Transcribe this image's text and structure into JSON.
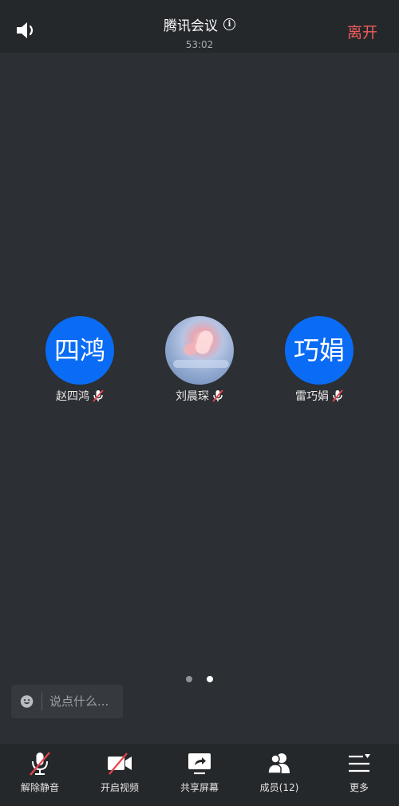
{
  "header": {
    "title": "腾讯会议",
    "info_icon": "info-icon",
    "timer": "53:02",
    "leave_label": "离开",
    "leave_color": "#f05b5b",
    "speaker_icon": "speaker-icon"
  },
  "participants": [
    {
      "avatar_text": "四鸿",
      "name": "赵四鸿",
      "avatar_type": "initials",
      "avatar_color": "#0a6cf5",
      "mic": "mic-muted-icon"
    },
    {
      "avatar_text": "",
      "name": "刘晨琛",
      "avatar_type": "photo",
      "mic": "mic-muted-icon"
    },
    {
      "avatar_text": "巧娟",
      "name": "雷巧娟",
      "avatar_type": "initials",
      "avatar_color": "#0a6cf5",
      "mic": "mic-muted-icon"
    }
  ],
  "pager": {
    "pages": 2,
    "current": 2
  },
  "chat": {
    "placeholder": "说点什么...",
    "emoji_icon": "emoji-icon"
  },
  "toolbar": {
    "unmute_label": "解除静音",
    "video_label": "开启视频",
    "share_label": "共享屏幕",
    "members_label": "成员(12)",
    "more_label": "更多"
  }
}
